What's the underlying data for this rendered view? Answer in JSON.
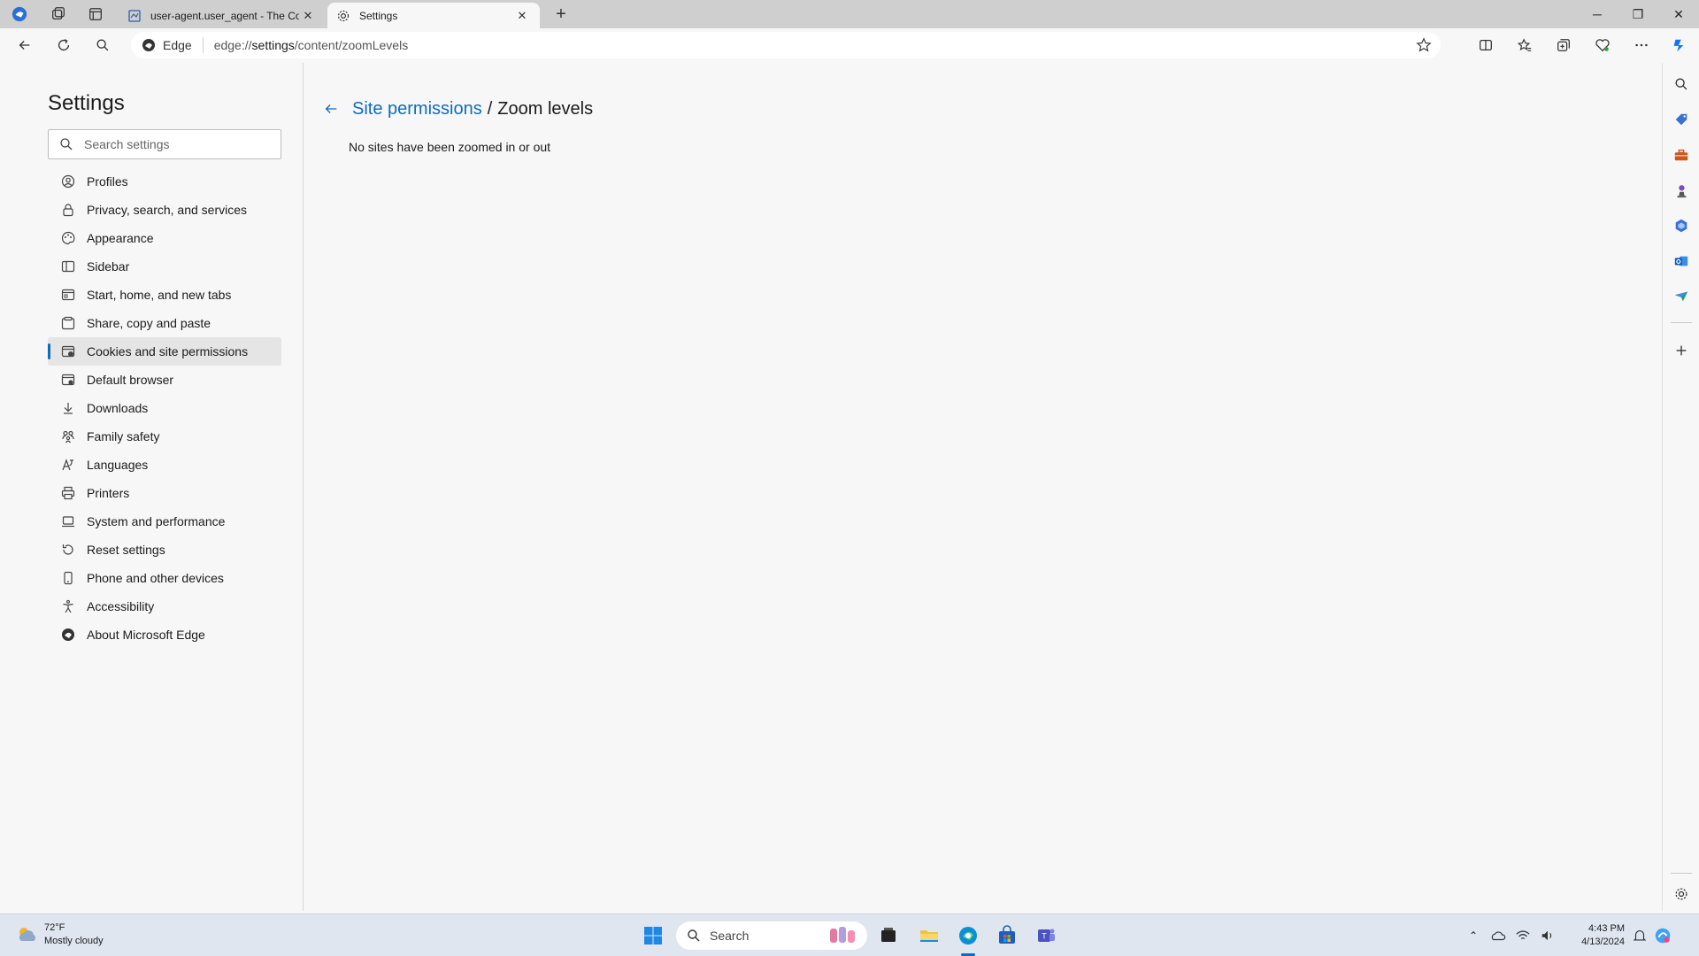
{
  "browser": {
    "tabs": [
      {
        "title": "user-agent.user_agent - The Coll",
        "favicon": "book-icon",
        "active": false
      },
      {
        "title": "Settings",
        "favicon": "gear-icon",
        "active": true
      }
    ],
    "address": {
      "prefix": "Edge",
      "url_scheme": "edge://",
      "url_host": "settings",
      "url_path": "/content/zoomLevels"
    }
  },
  "settings": {
    "title": "Settings",
    "search_placeholder": "Search settings",
    "nav_items": [
      {
        "label": "Profiles",
        "icon": "profile-icon"
      },
      {
        "label": "Privacy, search, and services",
        "icon": "lock-icon"
      },
      {
        "label": "Appearance",
        "icon": "palette-icon"
      },
      {
        "label": "Sidebar",
        "icon": "sidebar-icon"
      },
      {
        "label": "Start, home, and new tabs",
        "icon": "home-tabs-icon"
      },
      {
        "label": "Share, copy and paste",
        "icon": "share-icon"
      },
      {
        "label": "Cookies and site permissions",
        "icon": "cookies-icon",
        "selected": true
      },
      {
        "label": "Default browser",
        "icon": "browser-icon"
      },
      {
        "label": "Downloads",
        "icon": "download-icon"
      },
      {
        "label": "Family safety",
        "icon": "family-icon"
      },
      {
        "label": "Languages",
        "icon": "languages-icon"
      },
      {
        "label": "Printers",
        "icon": "printer-icon"
      },
      {
        "label": "System and performance",
        "icon": "laptop-icon"
      },
      {
        "label": "Reset settings",
        "icon": "reset-icon"
      },
      {
        "label": "Phone and other devices",
        "icon": "phone-icon"
      },
      {
        "label": "Accessibility",
        "icon": "accessibility-icon"
      },
      {
        "label": "About Microsoft Edge",
        "icon": "edge-logo-icon"
      }
    ]
  },
  "page": {
    "breadcrumb_parent": "Site permissions",
    "breadcrumb_separator": "/",
    "breadcrumb_current": "Zoom levels",
    "empty_message": "No sites have been zoomed in or out"
  },
  "taskbar": {
    "weather_temp": "72°F",
    "weather_desc": "Mostly cloudy",
    "search_label": "Search",
    "time": "4:43 PM",
    "date": "4/13/2024"
  },
  "colors": {
    "accent": "#0f6cbd",
    "titlebar": "#cfcfcf",
    "background": "#f7f7f7"
  }
}
